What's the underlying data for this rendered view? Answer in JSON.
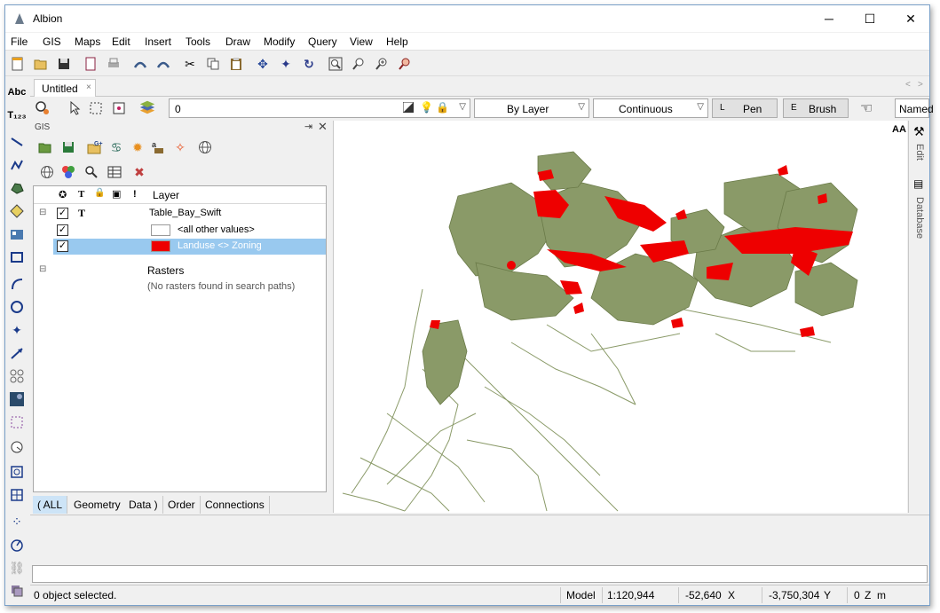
{
  "window": {
    "title": "Albion"
  },
  "menu": [
    "File",
    "GIS",
    "Maps",
    "Edit",
    "Insert",
    "Tools",
    "Draw",
    "Modify",
    "Query",
    "View",
    "Help"
  ],
  "doc_tab": {
    "label": "Untitled",
    "close": "×"
  },
  "props": {
    "layer_value": "0",
    "linetype_value": "By Layer",
    "style_value": "Continuous",
    "pen_key": "L",
    "pen_label": "Pen",
    "brush_key": "E",
    "brush_label": "Brush",
    "named_label": "Named"
  },
  "gis": {
    "panel_title": "GIS",
    "layer_header": "Layer",
    "header_icons": [
      "✪",
      "T",
      "🔒",
      "▣",
      "!"
    ],
    "table_name": "Table_Bay_Swift",
    "table_glyph": "T",
    "rows": [
      {
        "label": "<all other values>",
        "color": "#ffffff"
      },
      {
        "label": "Landuse <> Zoning",
        "color": "#ee0000"
      }
    ],
    "rasters_label": "Rasters",
    "no_rasters": "(No rasters found in search paths)",
    "bottom_tabs": [
      "( ALL",
      "Geometry",
      "Data )",
      "Order",
      "Connections"
    ]
  },
  "sidebar": {
    "edit_label": "Edit",
    "database_label": "Database",
    "aa_label": "AA"
  },
  "status": {
    "selection": "0 object selected.",
    "mode": "Model",
    "scale": "1:120,944",
    "x_value": "-52,640",
    "x_unit": "X",
    "y_value": "-3,750,304",
    "y_unit": "Y",
    "z_value": "0",
    "z_unit": "Z",
    "unit": "m"
  },
  "colors": {
    "selection": "#99c9ef",
    "map_fill": "#8a9a68",
    "map_red": "#ee0000"
  }
}
